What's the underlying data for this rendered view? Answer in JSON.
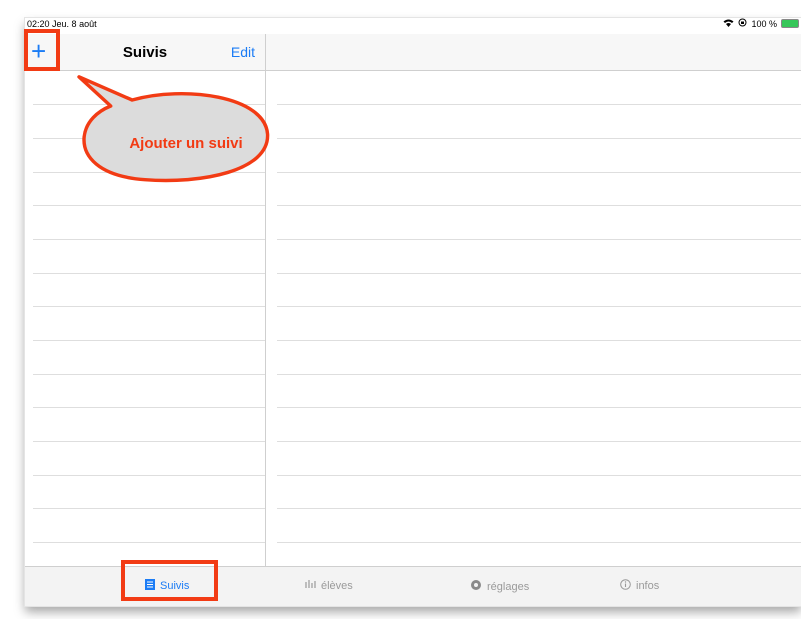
{
  "status_bar": {
    "time": "02:20",
    "date": "Jeu. 8 août",
    "battery": "100 %"
  },
  "nav": {
    "add_label": "+",
    "title": "Suivis",
    "edit_label": "Edit"
  },
  "callout": {
    "text": "Ajouter un suivi"
  },
  "tabs": [
    {
      "label": "Suivis",
      "icon": "list-icon",
      "active": true
    },
    {
      "label": "élèves",
      "icon": "people-icon",
      "active": false
    },
    {
      "label": "réglages",
      "icon": "gear-icon",
      "active": false
    },
    {
      "label": "infos",
      "icon": "info-icon",
      "active": false
    }
  ],
  "colors": {
    "accent": "#1b7cf5",
    "highlight": "#f23b14",
    "bubble": "#dcdcdc"
  }
}
